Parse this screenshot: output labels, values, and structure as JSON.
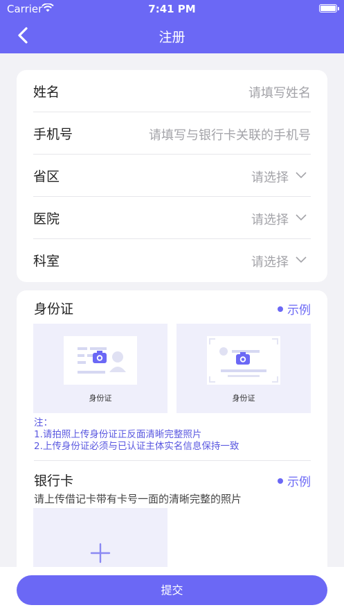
{
  "status_bar": {
    "carrier": "Carrier",
    "time": "7:41 PM"
  },
  "nav": {
    "title": "注册",
    "back_icon": "chevron-left-icon"
  },
  "form": {
    "rows": [
      {
        "label": "姓名",
        "placeholder": "请填写姓名"
      },
      {
        "label": "手机号",
        "placeholder": "请填写与银行卡关联的手机号"
      },
      {
        "label": "省区",
        "placeholder": "请选择"
      },
      {
        "label": "医院",
        "placeholder": "请选择"
      },
      {
        "label": "科室",
        "placeholder": "请选择"
      }
    ]
  },
  "id_card": {
    "title": "身份证",
    "example": "示例",
    "front_caption": "身份证",
    "back_caption": "身份证",
    "note_title": "注：",
    "note_1": "1.请拍照上传身份证正反面清晰完整照片",
    "note_2": "2.上传身份证必须与已认证主体实名信息保持一致"
  },
  "bank_card": {
    "title": "银行卡",
    "example": "示例",
    "description": "请上传借记卡带有卡号一面的清晰完整的照片"
  },
  "submit_label": "提交",
  "colors": {
    "primary": "#6b68f5",
    "placeholder": "#a3a3a8",
    "background": "#f2f2f6"
  }
}
